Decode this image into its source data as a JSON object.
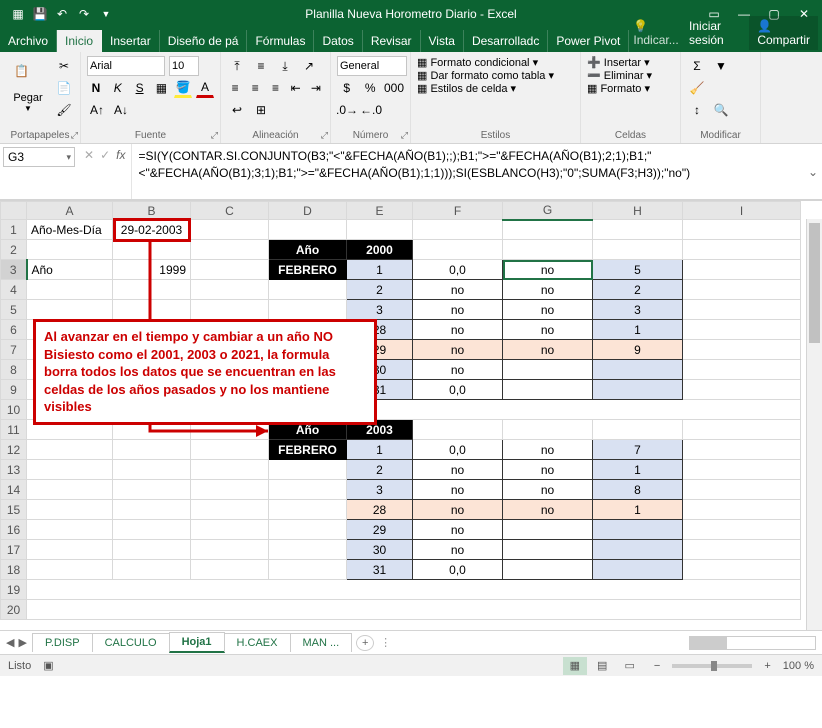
{
  "titlebar": {
    "title": "Planilla Nueva Horometro Diario - Excel"
  },
  "tabs": {
    "archivo": "Archivo",
    "inicio": "Inicio",
    "insertar": "Insertar",
    "diseno": "Diseño de pá",
    "formulas": "Fórmulas",
    "datos": "Datos",
    "revisar": "Revisar",
    "vista": "Vista",
    "desarrollador": "Desarrolladc",
    "powerpivot": "Power Pivot",
    "indicar": "Indicar...",
    "login": "Iniciar sesión",
    "share": "Compartir"
  },
  "ribbon": {
    "paste": "Pegar",
    "clipboard": "Portapapeles",
    "font_name": "Arial",
    "font_size": "10",
    "font_group": "Fuente",
    "align_group": "Alineación",
    "number_group": "Número",
    "number_format": "General",
    "styles_group": "Estilos",
    "cond_format": "Formato condicional",
    "tbl_format": "Dar formato como tabla",
    "cell_styles": "Estilos de celda",
    "cells_group": "Celdas",
    "insert": "Insertar",
    "delete": "Eliminar",
    "format": "Formato",
    "edit_group": "Modificar"
  },
  "namebox": "G3",
  "formula": "=SI(Y(CONTAR.SI.CONJUNTO(B3;\"<\"&FECHA(AÑO(B1);;);B1;\">=\"&FECHA(AÑO(B1);2;1);B1;\"<\"&FECHA(AÑO(B1);3;1);B1;\">=\"&FECHA(AÑO(B1);1;1)));SI(ESBLANCO(H3);\"0\";SUMA(F3;H3));\"no\")",
  "cells": {
    "A1": "Año-Mes-Día",
    "B1": "29-02-2003",
    "A3": "Año",
    "B3": "1999",
    "D2": "Año",
    "E2": "2000",
    "D3": "FEBRERO",
    "E3": "1",
    "F3": "0,0",
    "G3": "no",
    "H3": "5",
    "E4": "2",
    "F4": "no",
    "G4": "no",
    "H4": "2",
    "E5": "3",
    "F5": "no",
    "G5": "no",
    "H5": "3",
    "E6": "28",
    "F6": "no",
    "G6": "no",
    "H6": "1",
    "E7": "29",
    "F7": "no",
    "G7": "no",
    "H7": "9",
    "E8": "30",
    "F8": "no",
    "E9": "31",
    "F9": "0,0",
    "D11": "Año",
    "E11": "2003",
    "D12": "FEBRERO",
    "E12": "1",
    "F12": "0,0",
    "G12": "no",
    "H12": "7",
    "E13": "2",
    "F13": "no",
    "G13": "no",
    "H13": "1",
    "E14": "3",
    "F14": "no",
    "G14": "no",
    "H14": "8",
    "E15": "28",
    "F15": "no",
    "G15": "no",
    "H15": "1",
    "E16": "29",
    "F16": "no",
    "E17": "30",
    "F17": "no",
    "E18": "31",
    "F18": "0,0"
  },
  "annotation": "Al avanzar en el tiempo y cambiar a un año NO Bisiesto como el 2001, 2003 o 2021, la formula borra todos los datos que se encuentran en las celdas de los años pasados y no los mantiene visibles",
  "sheets": {
    "s1": "P.DISP",
    "s2": "CALCULO",
    "s3": "Hoja1",
    "s4": "H.CAEX",
    "s5": "MAN  ..."
  },
  "status": {
    "ready": "Listo",
    "zoom": "100 %"
  },
  "chart_data": {
    "type": "table",
    "title": "Spreadsheet cell values",
    "sheets": [
      {
        "year": 2000,
        "month": "FEBRERO",
        "rows": [
          {
            "day": 1,
            "F": "0,0",
            "G": "no",
            "H": 5
          },
          {
            "day": 2,
            "F": "no",
            "G": "no",
            "H": 2
          },
          {
            "day": 3,
            "F": "no",
            "G": "no",
            "H": 3
          },
          {
            "day": 28,
            "F": "no",
            "G": "no",
            "H": 1
          },
          {
            "day": 29,
            "F": "no",
            "G": "no",
            "H": 9
          },
          {
            "day": 30,
            "F": "no"
          },
          {
            "day": 31,
            "F": "0,0"
          }
        ]
      },
      {
        "year": 2003,
        "month": "FEBRERO",
        "rows": [
          {
            "day": 1,
            "F": "0,0",
            "G": "no",
            "H": 7
          },
          {
            "day": 2,
            "F": "no",
            "G": "no",
            "H": 1
          },
          {
            "day": 3,
            "F": "no",
            "G": "no",
            "H": 8
          },
          {
            "day": 28,
            "F": "no",
            "G": "no",
            "H": 1
          },
          {
            "day": 29,
            "F": "no"
          },
          {
            "day": 30,
            "F": "no"
          },
          {
            "day": 31,
            "F": "0,0"
          }
        ]
      }
    ]
  }
}
